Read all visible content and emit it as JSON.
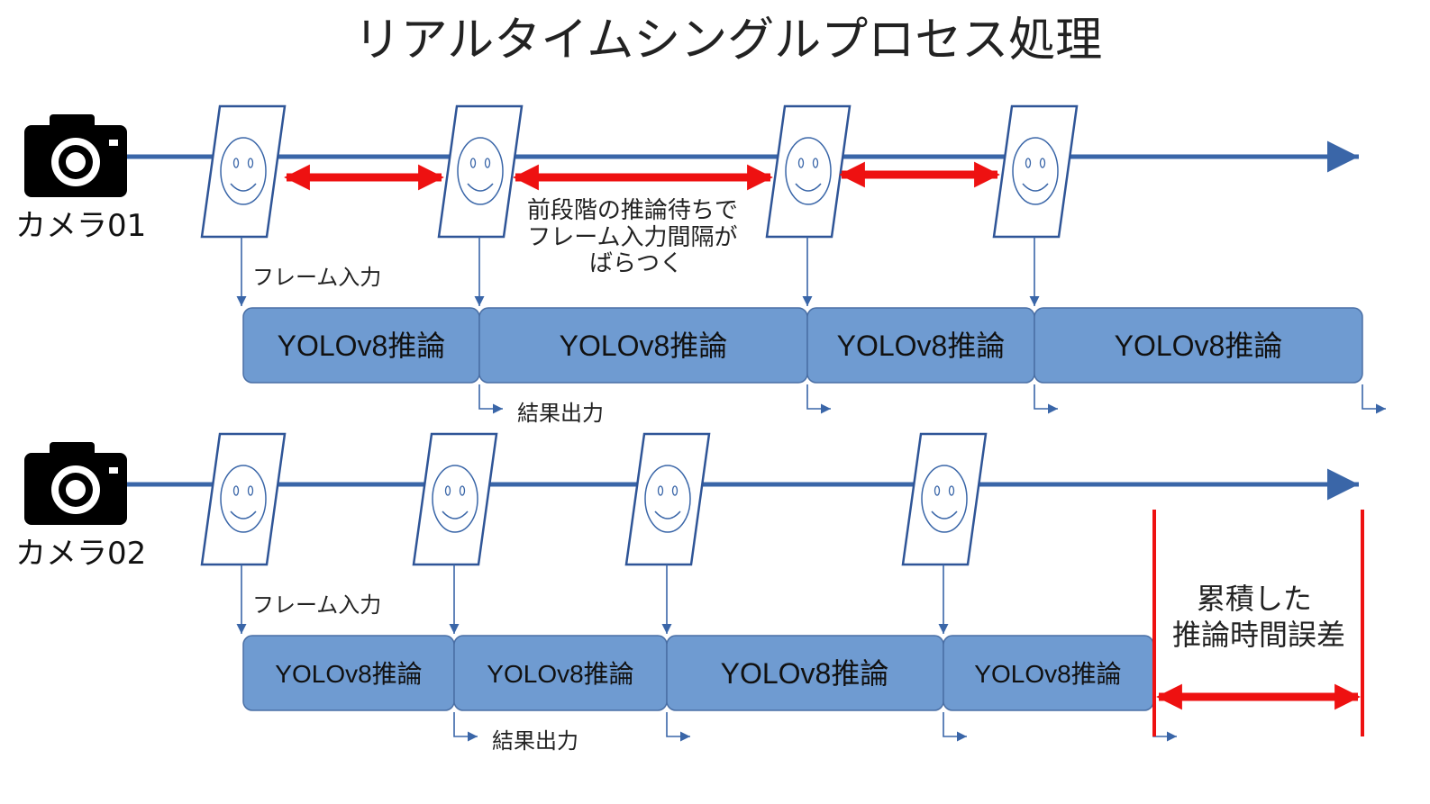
{
  "title": "リアルタイムシングルプロセス処理",
  "colors": {
    "timeline": "#3a66a8",
    "box_fill": "#6f9bd1",
    "box_stroke": "#4a6fa5",
    "frame_stroke": "#2f5597",
    "highlight": "#ee1111"
  },
  "icons": {
    "camera": "camera-icon",
    "face": "smiley-face-icon"
  },
  "camera1": {
    "label": "カメラ01",
    "frame_input_label": "フレーム入力",
    "result_label": "結果出力",
    "inference_boxes": [
      "YOLOv8推論",
      "YOLOv8推論",
      "YOLOv8推論",
      "YOLOv8推論"
    ],
    "note_lines": [
      "前段階の推論待ちで",
      "フレーム入力間隔が",
      "ばらつく"
    ]
  },
  "camera2": {
    "label": "カメラ02",
    "frame_input_label": "フレーム入力",
    "result_label": "結果出力",
    "inference_boxes": [
      "YOLOv8推論",
      "YOLOv8推論",
      "YOLOv8推論",
      "YOLOv8推論"
    ],
    "error_lines": [
      "累積した",
      "推論時間誤差"
    ]
  }
}
